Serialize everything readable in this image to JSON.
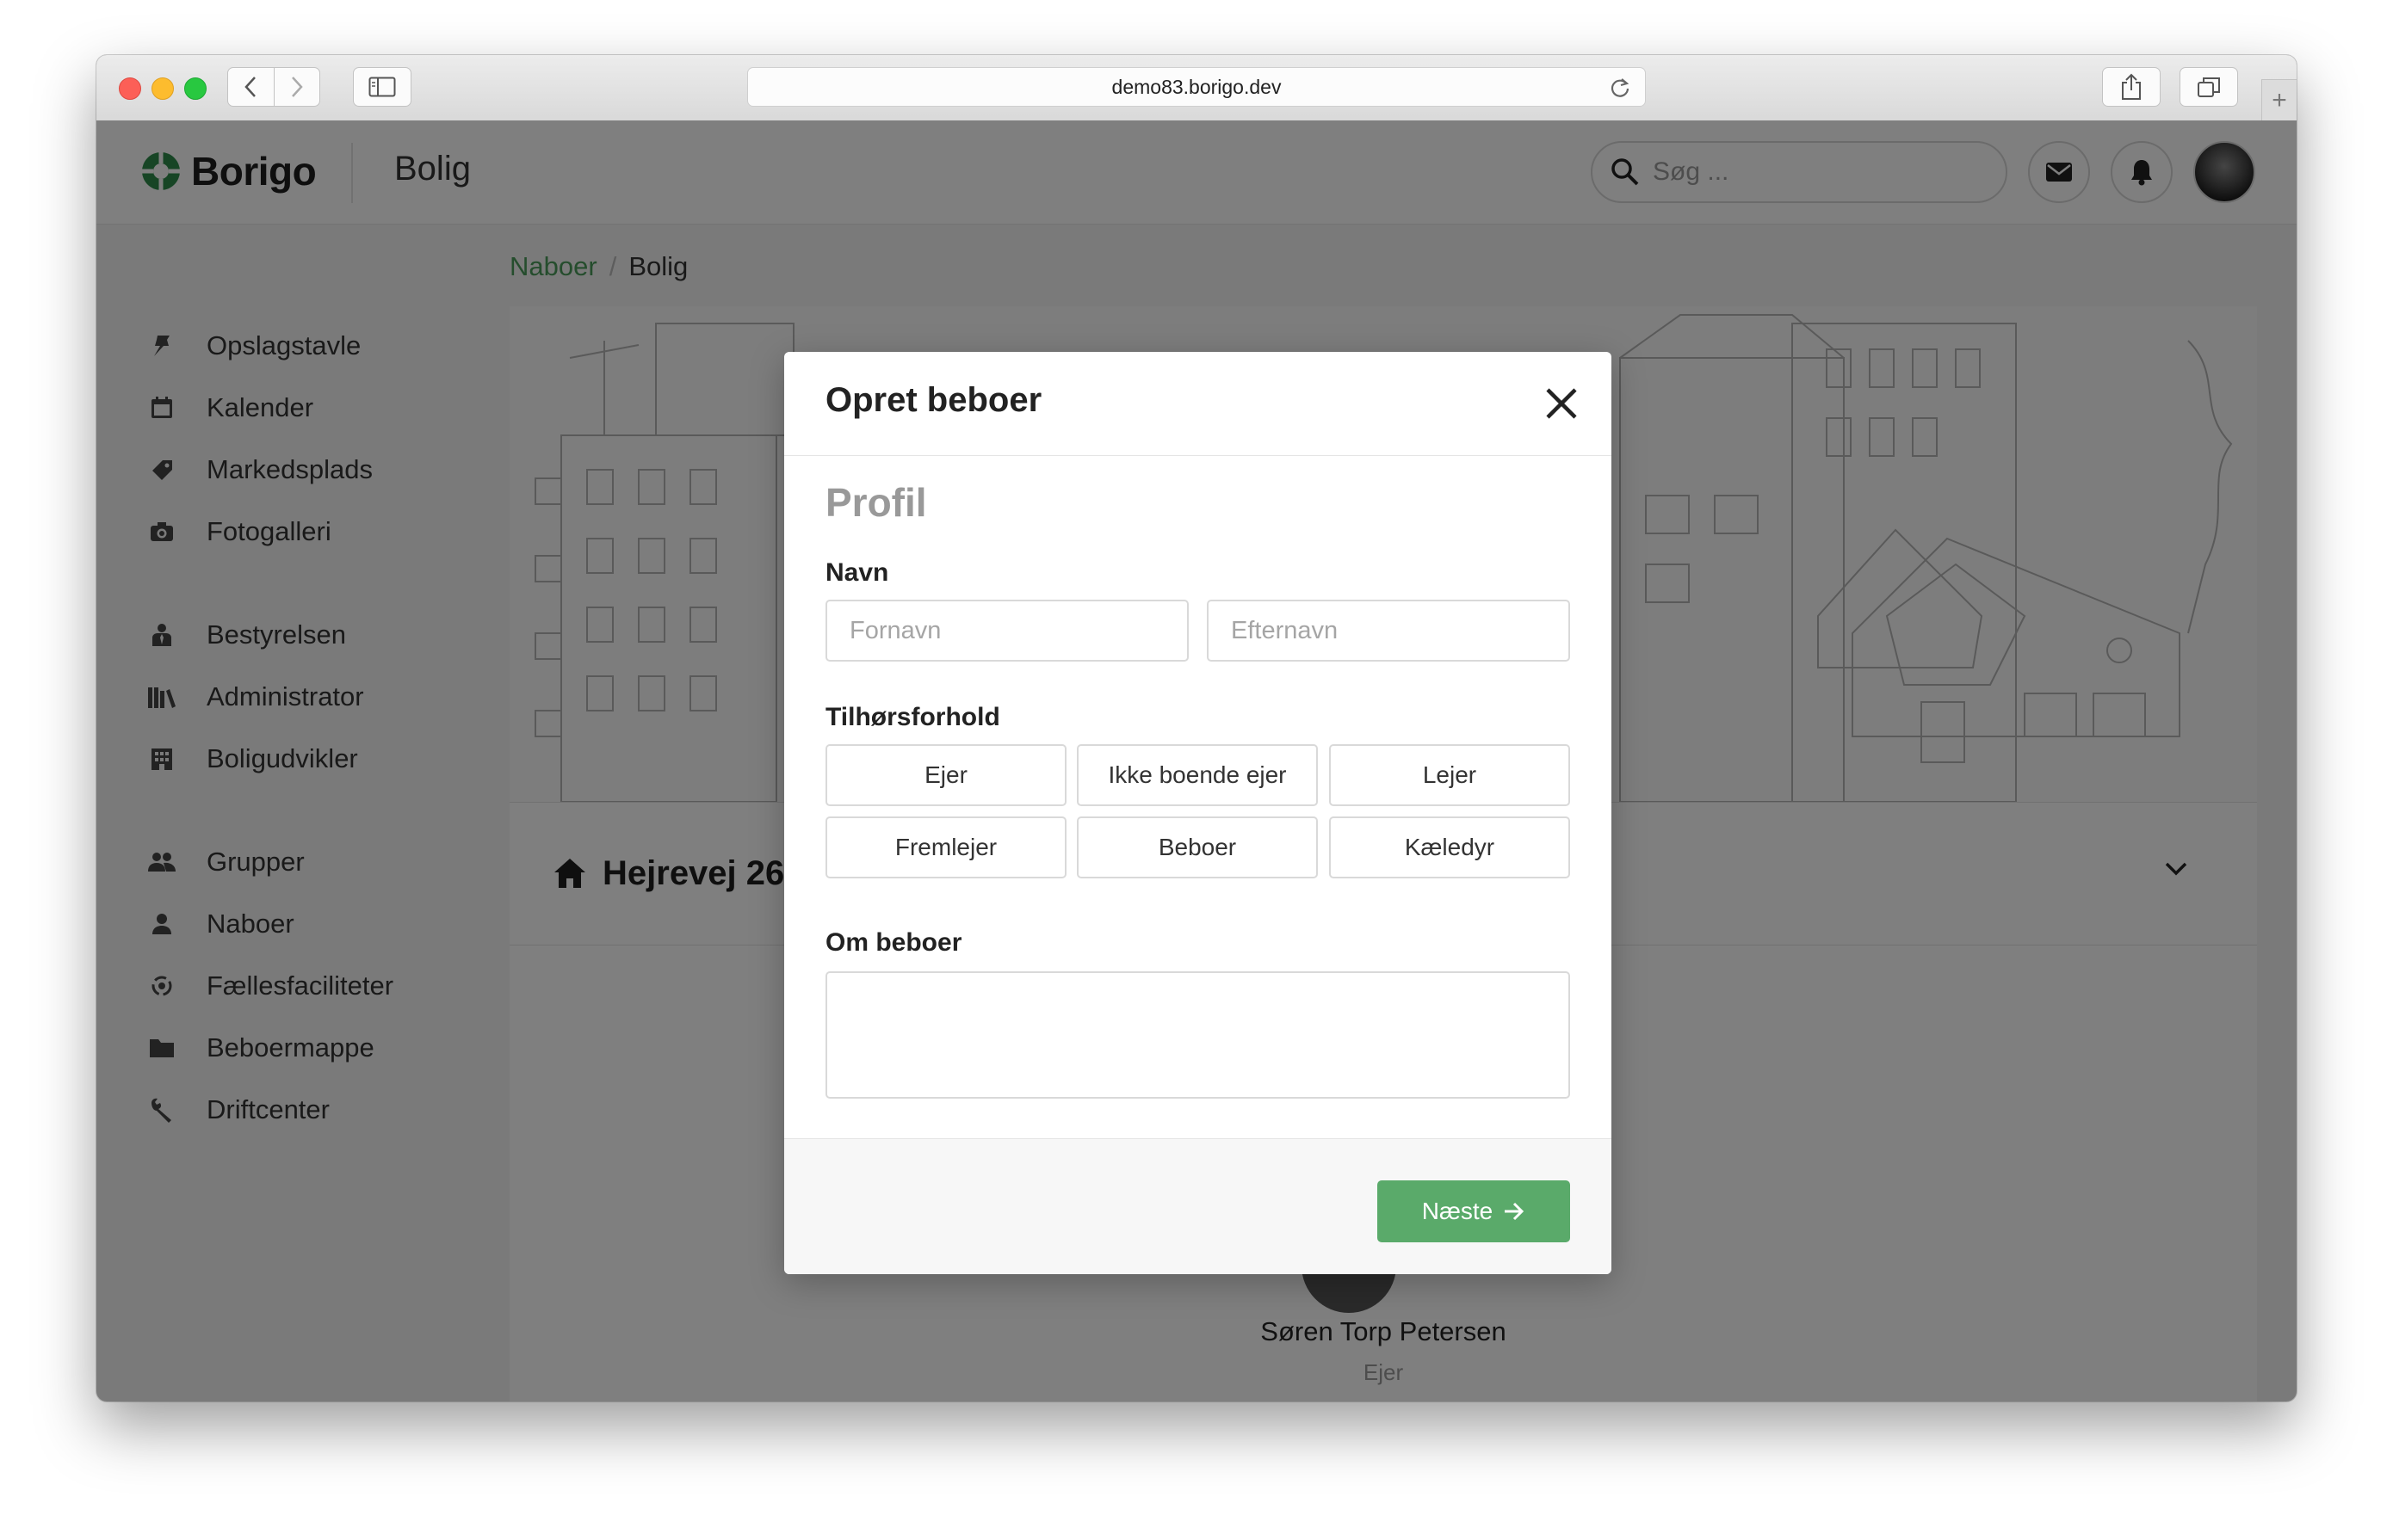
{
  "browser": {
    "url": "demo83.borigo.dev"
  },
  "topnav": {
    "brand": "Borigo",
    "section": "Bolig",
    "search_placeholder": "Søg ..."
  },
  "sidebar": {
    "items": [
      {
        "label": "Opslagstavle",
        "icon": "pin-icon"
      },
      {
        "label": "Kalender",
        "icon": "calendar-icon"
      },
      {
        "label": "Markedsplads",
        "icon": "tag-icon"
      },
      {
        "label": "Fotogalleri",
        "icon": "camera-icon"
      },
      {
        "label": "Bestyrelsen",
        "icon": "person-tie-icon"
      },
      {
        "label": "Administrator",
        "icon": "books-icon"
      },
      {
        "label": "Boligudvikler",
        "icon": "building-icon"
      },
      {
        "label": "Grupper",
        "icon": "people-icon"
      },
      {
        "label": "Naboer",
        "icon": "person-icon"
      },
      {
        "label": "Fællesfaciliteter",
        "icon": "facilities-icon"
      },
      {
        "label": "Beboermappe",
        "icon": "folder-icon"
      },
      {
        "label": "Driftcenter",
        "icon": "wrench-icon"
      }
    ]
  },
  "breadcrumb": {
    "parent": "Naboer",
    "separator": "/",
    "current": "Bolig"
  },
  "card": {
    "address": "Hejrevej 26",
    "resident_name": "Søren Torp Petersen",
    "resident_role": "Ejer"
  },
  "modal": {
    "title": "Opret beboer",
    "step_title": "Profil",
    "name_label": "Navn",
    "first_name_placeholder": "Fornavn",
    "last_name_placeholder": "Efternavn",
    "relation_label": "Tilhørsforhold",
    "relations": [
      "Ejer",
      "Ikke boende ejer",
      "Lejer",
      "Fremlejer",
      "Beboer",
      "Kæledyr"
    ],
    "about_label": "Om beboer",
    "about_value": "",
    "next_label": "Næste"
  },
  "colors": {
    "accent": "#5aaa6a",
    "link": "#4a9a5a",
    "overlay": "rgba(0,0,0,0.5)"
  }
}
